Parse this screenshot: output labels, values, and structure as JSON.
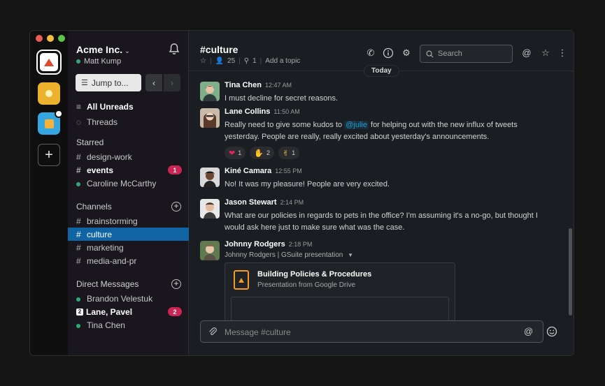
{
  "workspace": {
    "team_name": "Acme Inc.",
    "user_name": "Matt Kump"
  },
  "sidebar": {
    "jump_label": "Jump to...",
    "all_unreads": "All Unreads",
    "threads": "Threads",
    "starred_header": "Starred",
    "starred": [
      {
        "label": "design-work",
        "kind": "channel",
        "bold": false
      },
      {
        "label": "events",
        "kind": "channel",
        "bold": true,
        "badge": "1"
      },
      {
        "label": "Caroline McCarthy",
        "kind": "dm",
        "bold": false
      }
    ],
    "channels_header": "Channels",
    "channels": [
      {
        "label": "brainstorming",
        "active": false
      },
      {
        "label": "culture",
        "active": true
      },
      {
        "label": "marketing",
        "active": false
      },
      {
        "label": "media-and-pr",
        "active": false
      }
    ],
    "dms_header": "Direct Messages",
    "dms": [
      {
        "label": "Brandon Velestuk",
        "group": false,
        "bold": false
      },
      {
        "label": "Lane, Pavel",
        "group": true,
        "group_count": "2",
        "bold": true,
        "badge": "2"
      },
      {
        "label": "Tina Chen",
        "group": false,
        "bold": false
      }
    ]
  },
  "channel": {
    "title": "#culture",
    "members": "25",
    "pins": "1",
    "add_topic": "Add a topic",
    "search_placeholder": "Search",
    "divider": "Today"
  },
  "messages": [
    {
      "name": "Tina Chen",
      "time": "12:47 AM",
      "text": "I must decline for secret reasons."
    },
    {
      "name": "Lane Collins",
      "time": "11:50 AM",
      "text_before": "Really need to give some kudos to ",
      "mention": "@julie",
      "text_after": " for helping out with the new influx of tweets yesterday. People are really, really excited about yesterday's announcements.",
      "reactions": [
        {
          "emoji": "heart",
          "count": "1"
        },
        {
          "emoji": "clap",
          "count": "2"
        },
        {
          "emoji": "victory",
          "count": "1"
        }
      ]
    },
    {
      "name": "Kiné Camara",
      "time": "12:55 PM",
      "text": "No! It was my pleasure! People are very excited."
    },
    {
      "name": "Jason Stewart",
      "time": "2:14 PM",
      "text": "What are our policies in regards to pets in the office? I'm assuming it's a no-go, but thought I would ask here just to make sure what was the case."
    },
    {
      "name": "Johnny Rodgers",
      "time": "2:18 PM",
      "attachment_line": "Johnny Rodgers | GSuite presentation",
      "card": {
        "title": "Building Policies & Procedures",
        "subtitle": "Presentation from Google Drive"
      }
    }
  ],
  "composer": {
    "placeholder": "Message #culture"
  },
  "colors": {
    "accent": "#1164a3",
    "badge": "#cd2553",
    "online": "#2bac76",
    "mention": "#1d9bd1"
  }
}
